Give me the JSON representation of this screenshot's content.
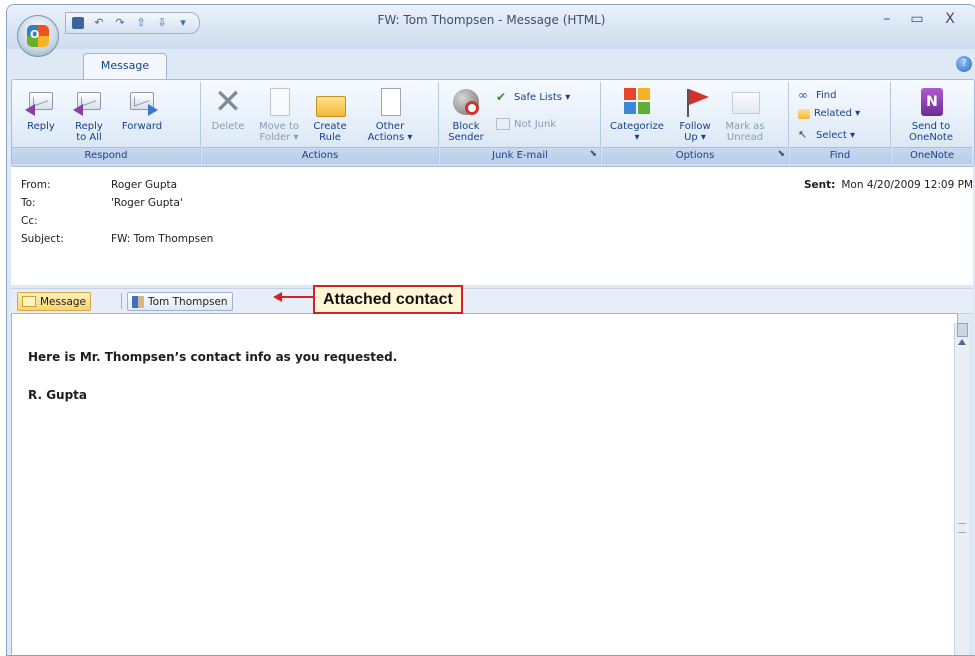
{
  "window": {
    "title": "FW: Tom Thompsen - Message (HTML)",
    "controls": {
      "minimize": "–",
      "maximize": "▭",
      "close": "X"
    }
  },
  "quick_access": {
    "customize": "▾"
  },
  "tabs": [
    {
      "label": "Message",
      "active": true
    }
  ],
  "ribbon": {
    "groups": {
      "respond": "Respond",
      "actions": "Actions",
      "junk": "Junk E-mail",
      "options": "Options",
      "find": "Find",
      "onenote": "OneNote"
    },
    "buttons": {
      "reply": "Reply",
      "reply_all": "Reply\nto All",
      "forward": "Forward",
      "delete": "Delete",
      "move_to_folder": "Move to\nFolder ▾",
      "create_rule": "Create\nRule",
      "other_actions": "Other\nActions ▾",
      "block_sender": "Block\nSender",
      "safe_lists": "Safe Lists ▾",
      "not_junk": "Not Junk",
      "categorize": "Categorize\n▾",
      "follow_up": "Follow\nUp ▾",
      "mark_as_unread": "Mark as\nUnread",
      "find": "Find",
      "related": "Related ▾",
      "select": "Select ▾",
      "send_to_onenote": "Send to\nOneNote"
    }
  },
  "header": {
    "from_label": "From:",
    "from_value": "Roger Gupta",
    "to_label": "To:",
    "to_value": "'Roger Gupta'",
    "cc_label": "Cc:",
    "cc_value": "",
    "subject_label": "Subject:",
    "subject_value": "FW: Tom Thompsen",
    "sent_label": "Sent:",
    "sent_value": "Mon 4/20/2009 12:09 PM"
  },
  "attachments": {
    "message_tab": "Message",
    "contact": "Tom Thompsen"
  },
  "callout": "Attached contact",
  "body": {
    "line1": "Here is Mr. Thompsen’s contact info as you requested.",
    "signature": "R. Gupta"
  },
  "colors": {
    "accent": "#15428b",
    "callout_red": "#d12229",
    "ribbon_bg": "#dfeaf7"
  }
}
